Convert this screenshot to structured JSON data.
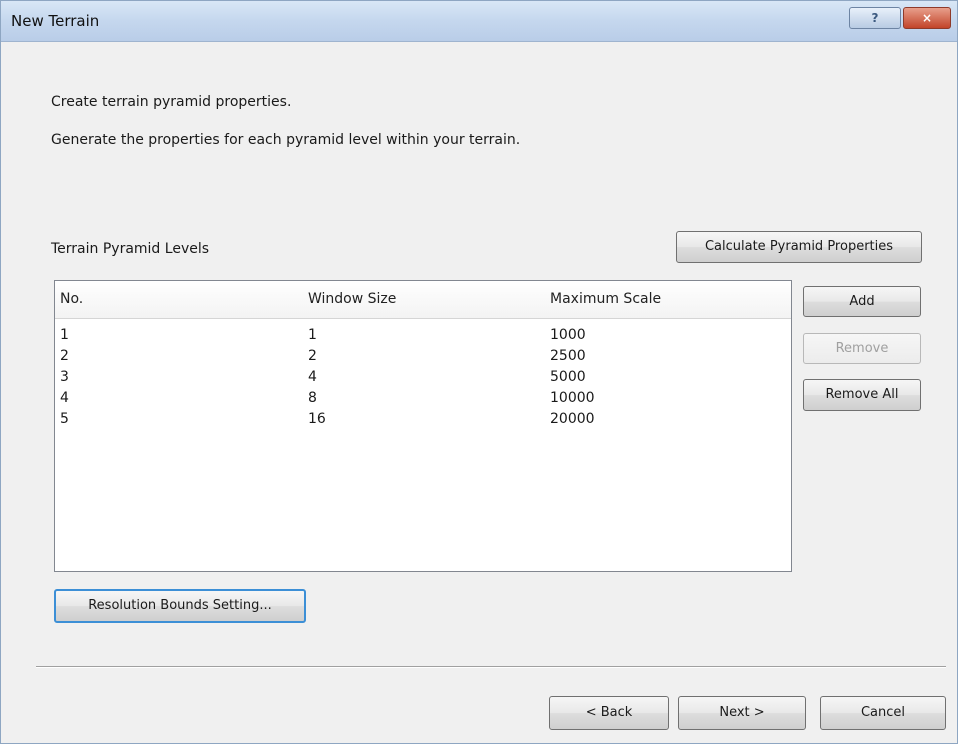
{
  "window": {
    "title": "New Terrain",
    "help_symbol": "?",
    "close_symbol": "×"
  },
  "intro": {
    "line1": "Create terrain pyramid properties.",
    "line2": "Generate the properties for each pyramid level within your terrain."
  },
  "levels": {
    "label": "Terrain Pyramid Levels",
    "calculate_button": "Calculate Pyramid Properties",
    "columns": [
      "No.",
      "Window Size",
      "Maximum Scale"
    ],
    "rows": [
      [
        "1",
        "1",
        "1000"
      ],
      [
        "2",
        "2",
        "2500"
      ],
      [
        "3",
        "4",
        "5000"
      ],
      [
        "4",
        "8",
        "10000"
      ],
      [
        "5",
        "16",
        "20000"
      ]
    ]
  },
  "side_buttons": {
    "add": "Add",
    "remove": "Remove",
    "remove_all": "Remove All"
  },
  "resolution_button": "Resolution Bounds Setting...",
  "footer": {
    "back": "< Back",
    "next": "Next >",
    "cancel": "Cancel"
  }
}
